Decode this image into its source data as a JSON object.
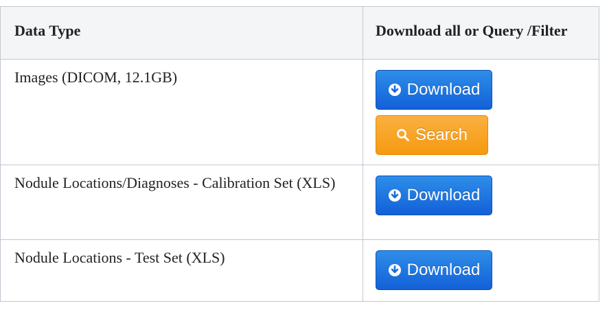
{
  "table": {
    "headers": {
      "data_type": "Data Type",
      "download": "Download all or Query /Filter"
    },
    "rows": [
      {
        "label": "Images (DICOM, 12.1GB)",
        "download_label": "Download",
        "search_label": "Search"
      },
      {
        "label": "Nodule Locations/Diagnoses - Calibration Set (XLS)",
        "download_label": "Download"
      },
      {
        "label": "Nodule Locations - Test Set (XLS)",
        "download_label": "Download"
      }
    ]
  },
  "colors": {
    "download_button": "#1a73e0",
    "search_button": "#f7a21e",
    "header_background": "#f4f5f7",
    "border": "#c1c7d0"
  },
  "icons": {
    "download": "circle-arrow-down-icon",
    "search": "magnifier-icon"
  }
}
